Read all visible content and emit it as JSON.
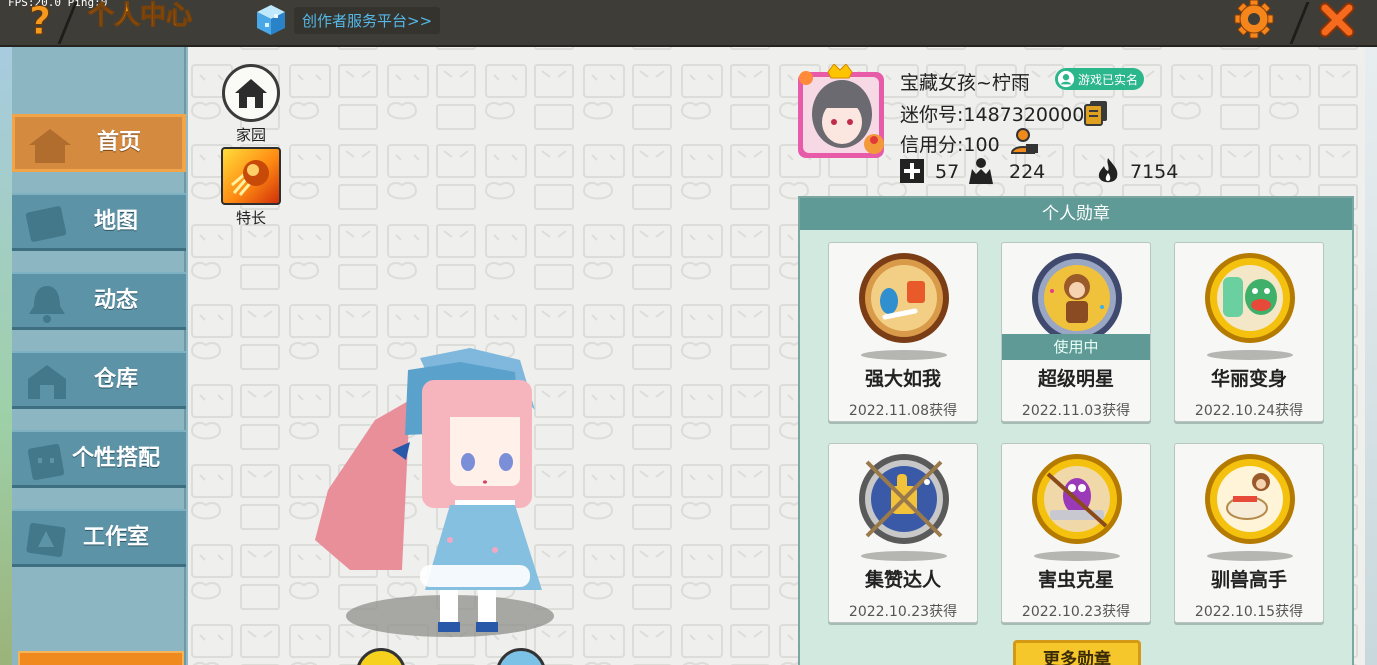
{
  "status": {
    "fps_text": "FPS:20.0 Ping:0"
  },
  "header": {
    "title": "个人中心",
    "creator_link": "创作者服务平台>>"
  },
  "sidebar": {
    "items": [
      {
        "label": "首页",
        "active": true
      },
      {
        "label": "地图",
        "active": false
      },
      {
        "label": "动态",
        "active": false
      },
      {
        "label": "仓库",
        "active": false
      },
      {
        "label": "个性搭配",
        "active": false
      },
      {
        "label": "工作室",
        "active": false
      }
    ]
  },
  "shortcuts": [
    {
      "label": "家园",
      "icon": "home-icon"
    },
    {
      "label": "特长",
      "icon": "skill-fireball-icon"
    }
  ],
  "profile": {
    "name": "宝藏女孩~柠雨",
    "verified_badge": "游戏已实名",
    "mini_id": "迷你号:1487320000",
    "credit": "信用分:100",
    "stats": [
      {
        "icon": "plus-icon",
        "value": "57"
      },
      {
        "icon": "fans-icon",
        "value": "224"
      },
      {
        "icon": "flame-icon",
        "value": "7154"
      }
    ]
  },
  "medals": {
    "title": "个人勋章",
    "in_use_label": "使用中",
    "items": [
      {
        "name": "强大如我",
        "date": "2022.11.08获得",
        "tier": "bronze",
        "in_use": false
      },
      {
        "name": "超级明星",
        "date": "2022.11.03获得",
        "tier": "silver",
        "in_use": true
      },
      {
        "name": "华丽变身",
        "date": "2022.10.24获得",
        "tier": "gold",
        "in_use": false
      },
      {
        "name": "集赞达人",
        "date": "2022.10.23获得",
        "tier": "silver",
        "in_use": false
      },
      {
        "name": "害虫克星",
        "date": "2022.10.23获得",
        "tier": "gold",
        "in_use": false
      },
      {
        "name": "驯兽高手",
        "date": "2022.10.15获得",
        "tier": "gold",
        "in_use": false
      }
    ],
    "more_button": "更多勋章"
  },
  "colors": {
    "accent_orange": "#f79a22",
    "teal": "#5f9a96",
    "sidebar_blue": "#5d93a6",
    "verified_green": "#2cb68c"
  }
}
